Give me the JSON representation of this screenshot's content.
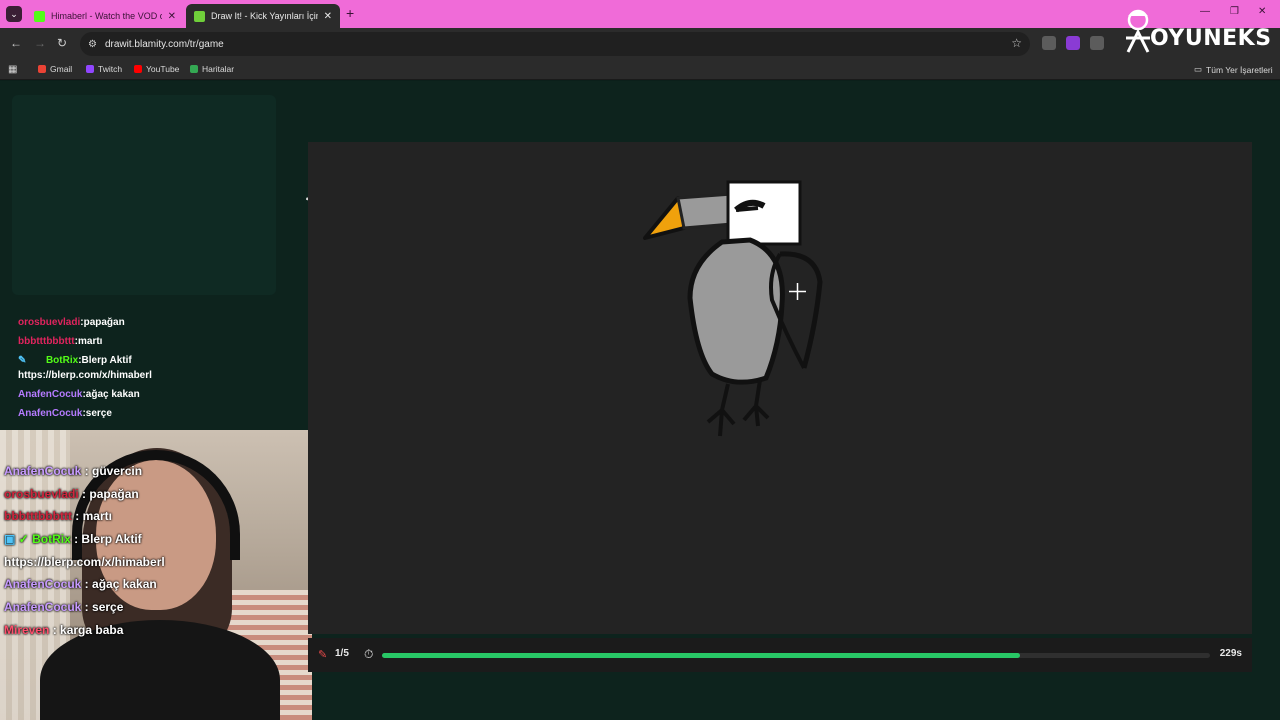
{
  "browser": {
    "tabs": [
      {
        "title": "Himaberl - Watch the VOD on Kick",
        "favicon_color": "#53fc18"
      },
      {
        "title": "Draw It! - Kick Yayınları İçin Çizim",
        "favicon_color": "#6fcf3a"
      }
    ],
    "url": "drawit.blamity.com/tr/game",
    "bookmarks": [
      {
        "label": "Gmail",
        "color": "#ea4335"
      },
      {
        "label": "Twitch",
        "color": "#9146ff"
      },
      {
        "label": "YouTube",
        "color": "#ff0000"
      },
      {
        "label": "Haritalar",
        "color": "#34a853"
      }
    ],
    "all_bookmarks": "Tüm Yer İşaretleri"
  },
  "watermark": {
    "text": "OYUNEKS"
  },
  "chat_top": [
    {
      "user": "orosbuevladi",
      "sep": ":",
      "msg": "papağan",
      "color": "#e0245e"
    },
    {
      "user": "bbbtttbbbttt",
      "sep": ":",
      "msg": "martı",
      "color": "#e0245e"
    },
    {
      "user": "BotRix",
      "sep": ":",
      "msg": "Blerp Aktif",
      "color": "#53fc18",
      "extra": "https://blerp.com/x/himaberl"
    },
    {
      "user": "AnafenCocuk",
      "sep": ":",
      "msg": "ağaç kakan",
      "color": "#b57bff"
    },
    {
      "user": "AnafenCocuk",
      "sep": ":",
      "msg": "serçe",
      "color": "#b57bff"
    }
  ],
  "overlay_chat": [
    {
      "user": "AnafenCocuk",
      "sep": " : ",
      "msg": "güvercin",
      "color": "#c79bff"
    },
    {
      "user": "orosbuevladi",
      "sep": " : ",
      "msg": "papağan",
      "color": "#d1253d"
    },
    {
      "user": "bbbtttbbbttt",
      "sep": " : ",
      "msg": "martı",
      "color": "#d1253d"
    },
    {
      "user": "BotRix",
      "sep": " : ",
      "msg": "Blerp Aktif",
      "color": "#53fc18"
    },
    {
      "user": "",
      "sep": "",
      "msg": "https://blerp.com/x/himaberl",
      "color": "#ffffff"
    },
    {
      "user": "AnafenCocuk",
      "sep": " : ",
      "msg": "ağaç kakan",
      "color": "#c79bff"
    },
    {
      "user": "AnafenCocuk",
      "sep": " : ",
      "msg": "serçe",
      "color": "#c79bff"
    },
    {
      "user": "Mireven",
      "sep": " : ",
      "msg": "karga baba",
      "color": "#ff4f6d"
    }
  ],
  "game": {
    "round_label": "1/5",
    "time_label": "229s",
    "progress": 0.77,
    "accent": "#28c766"
  }
}
